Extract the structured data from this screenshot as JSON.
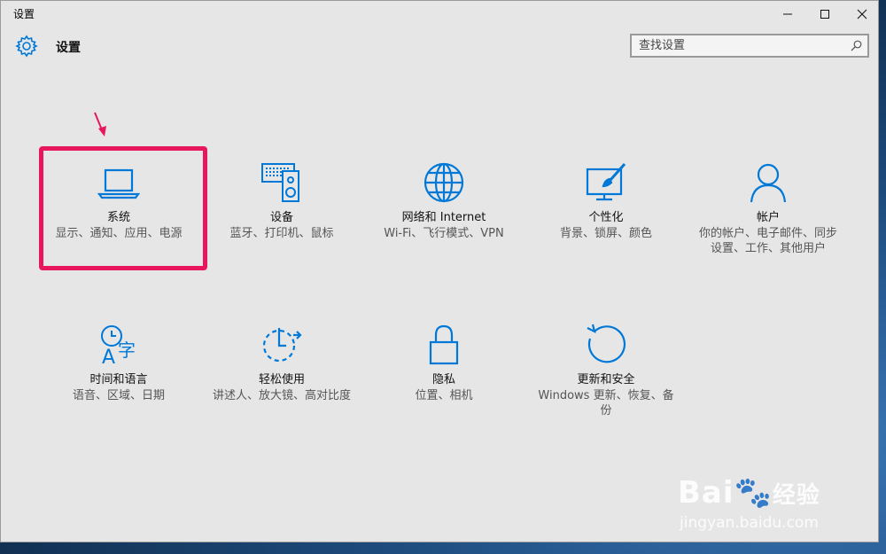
{
  "window": {
    "title": "设置"
  },
  "header": {
    "title": "设置"
  },
  "search": {
    "placeholder": "查找设置"
  },
  "tiles": [
    {
      "name": "系统",
      "desc": "显示、通知、应用、电源",
      "icon": "laptop-icon"
    },
    {
      "name": "设备",
      "desc": "蓝牙、打印机、鼠标",
      "icon": "devices-icon"
    },
    {
      "name": "网络和 Internet",
      "desc": "Wi-Fi、飞行模式、VPN",
      "icon": "globe-icon"
    },
    {
      "name": "个性化",
      "desc": "背景、锁屏、颜色",
      "icon": "paint-icon"
    },
    {
      "name": "帐户",
      "desc": "你的帐户、电子邮件、同步设置、工作、其他用户",
      "icon": "person-icon"
    },
    {
      "name": "时间和语言",
      "desc": "语音、区域、日期",
      "icon": "time-language-icon"
    },
    {
      "name": "轻松使用",
      "desc": "讲述人、放大镜、高对比度",
      "icon": "ease-of-access-icon"
    },
    {
      "name": "隐私",
      "desc": "位置、相机",
      "icon": "lock-icon"
    },
    {
      "name": "更新和安全",
      "desc": "Windows 更新、恢复、备份",
      "icon": "update-icon"
    }
  ],
  "watermark": {
    "brand": "Bai",
    "brand_tail": "经验",
    "url": "jingyan.baidu.com"
  },
  "colors": {
    "accent": "#0078d7",
    "highlight": "#e8175d"
  }
}
